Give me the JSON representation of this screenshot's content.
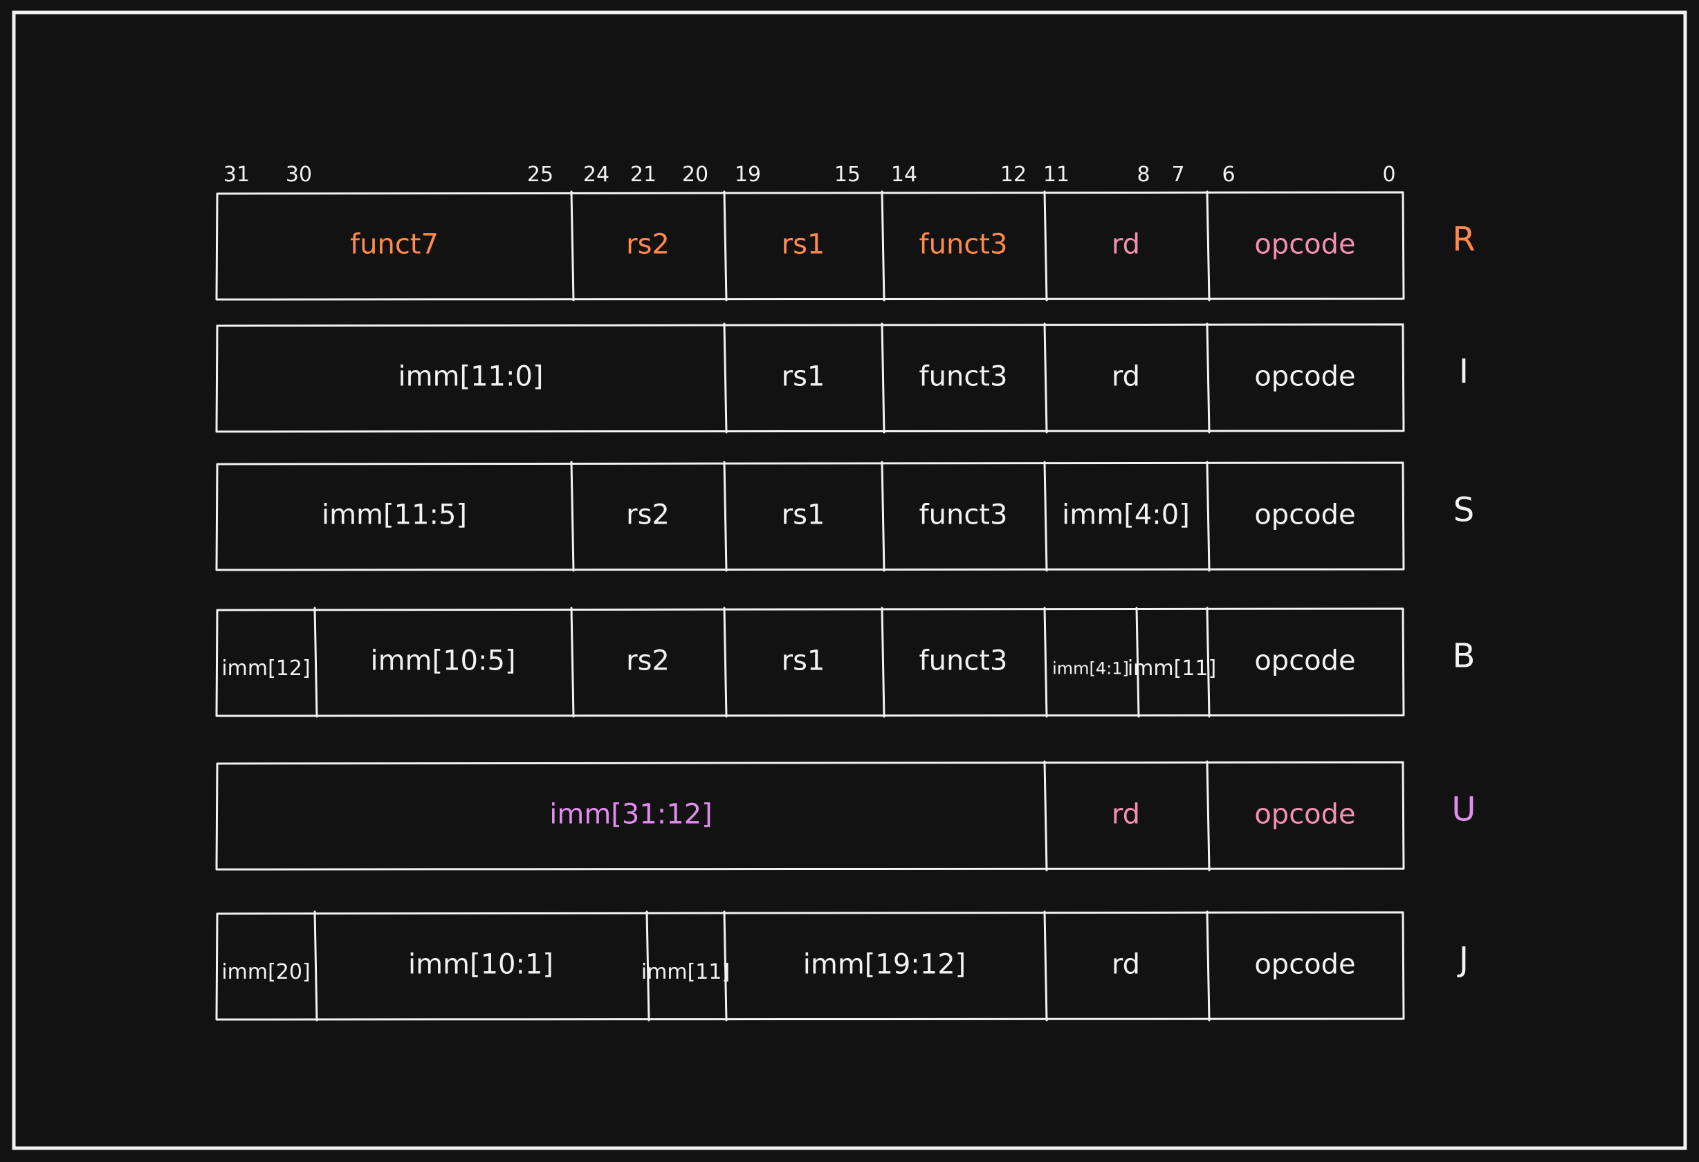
{
  "colors": {
    "background": "#121212",
    "stroke": "#f2f2f2",
    "orange": "#ff8a4c",
    "pink": "#f48fb1",
    "purple": "#e28cf0",
    "white": "#f2f2f2"
  },
  "bit_numbers": [
    "31",
    "30",
    "25",
    "24",
    "21",
    "20",
    "19",
    "15",
    "14",
    "12",
    "11",
    "8",
    "7",
    "6",
    "0"
  ],
  "formats": [
    {
      "type": "R",
      "type_color": "orange",
      "fields": [
        {
          "label": "funct7",
          "hi": 31,
          "lo": 25,
          "color": "orange"
        },
        {
          "label": "rs2",
          "hi": 24,
          "lo": 20,
          "color": "orange"
        },
        {
          "label": "rs1",
          "hi": 19,
          "lo": 15,
          "color": "orange"
        },
        {
          "label": "funct3",
          "hi": 14,
          "lo": 12,
          "color": "orange"
        },
        {
          "label": "rd",
          "hi": 11,
          "lo": 7,
          "color": "pink"
        },
        {
          "label": "opcode",
          "hi": 6,
          "lo": 0,
          "color": "pink"
        }
      ]
    },
    {
      "type": "I",
      "type_color": "white",
      "fields": [
        {
          "label": "imm[11:0]",
          "hi": 31,
          "lo": 20,
          "color": "white"
        },
        {
          "label": "rs1",
          "hi": 19,
          "lo": 15,
          "color": "white"
        },
        {
          "label": "funct3",
          "hi": 14,
          "lo": 12,
          "color": "white"
        },
        {
          "label": "rd",
          "hi": 11,
          "lo": 7,
          "color": "white"
        },
        {
          "label": "opcode",
          "hi": 6,
          "lo": 0,
          "color": "white"
        }
      ]
    },
    {
      "type": "S",
      "type_color": "white",
      "fields": [
        {
          "label": "imm[11:5]",
          "hi": 31,
          "lo": 25,
          "color": "white"
        },
        {
          "label": "rs2",
          "hi": 24,
          "lo": 20,
          "color": "white"
        },
        {
          "label": "rs1",
          "hi": 19,
          "lo": 15,
          "color": "white"
        },
        {
          "label": "funct3",
          "hi": 14,
          "lo": 12,
          "color": "white"
        },
        {
          "label": "imm[4:0]",
          "hi": 11,
          "lo": 7,
          "color": "white"
        },
        {
          "label": "opcode",
          "hi": 6,
          "lo": 0,
          "color": "white"
        }
      ]
    },
    {
      "type": "B",
      "type_color": "white",
      "fields": [
        {
          "label": "imm[12]",
          "hi": 31,
          "lo": 31,
          "color": "white",
          "small": true
        },
        {
          "label": "imm[10:5]",
          "hi": 30,
          "lo": 25,
          "color": "white"
        },
        {
          "label": "rs2",
          "hi": 24,
          "lo": 20,
          "color": "white"
        },
        {
          "label": "rs1",
          "hi": 19,
          "lo": 15,
          "color": "white"
        },
        {
          "label": "funct3",
          "hi": 14,
          "lo": 12,
          "color": "white"
        },
        {
          "label": "imm[4:1]",
          "hi": 11,
          "lo": 8,
          "color": "white",
          "small": true
        },
        {
          "label": "imm[11]",
          "hi": 7,
          "lo": 7,
          "color": "white",
          "small": true
        },
        {
          "label": "opcode",
          "hi": 6,
          "lo": 0,
          "color": "white"
        }
      ]
    },
    {
      "type": "U",
      "type_color": "purple",
      "fields": [
        {
          "label": "imm[31:12]",
          "hi": 31,
          "lo": 12,
          "color": "purple"
        },
        {
          "label": "rd",
          "hi": 11,
          "lo": 7,
          "color": "pink"
        },
        {
          "label": "opcode",
          "hi": 6,
          "lo": 0,
          "color": "pink"
        }
      ]
    },
    {
      "type": "J",
      "type_color": "white",
      "fields": [
        {
          "label": "imm[20]",
          "hi": 31,
          "lo": 31,
          "color": "white",
          "small": true
        },
        {
          "label": "imm[10:1]",
          "hi": 30,
          "lo": 21,
          "color": "white"
        },
        {
          "label": "imm[11]",
          "hi": 20,
          "lo": 20,
          "color": "white",
          "small": true
        },
        {
          "label": "imm[19:12]",
          "hi": 19,
          "lo": 12,
          "color": "white"
        },
        {
          "label": "rd",
          "hi": 11,
          "lo": 7,
          "color": "white"
        },
        {
          "label": "opcode",
          "hi": 6,
          "lo": 0,
          "color": "white"
        }
      ]
    }
  ]
}
